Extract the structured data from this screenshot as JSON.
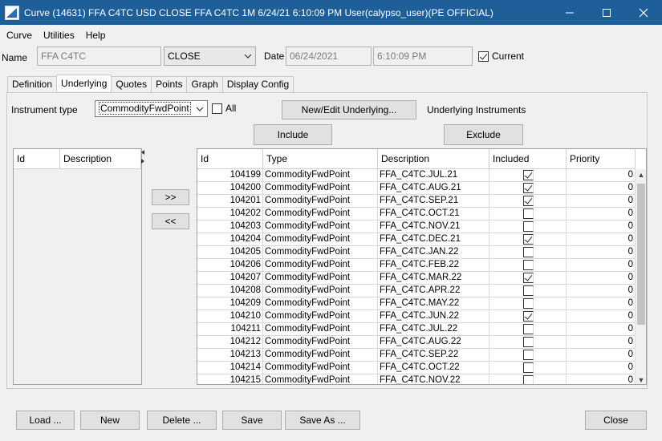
{
  "window": {
    "title": "Curve (14631) FFA C4TC USD CLOSE FFA C4TC 1M 6/24/21 6:10:09 PM User(calypso_user)(PE OFFICIAL)"
  },
  "menu": [
    "Curve",
    "Utilities",
    "Help"
  ],
  "name_row": {
    "name_label": "Name",
    "name_value": "FFA C4TC",
    "quote_set": "CLOSE",
    "date_label": "Date",
    "date_value": "06/24/2021",
    "time_value": "6:10:09 PM",
    "current_label": "Current",
    "current_checked": true
  },
  "tabs": [
    "Definition",
    "Underlying",
    "Quotes",
    "Points",
    "Graph",
    "Display Config"
  ],
  "active_tab": "Underlying",
  "underlying": {
    "instrument_type_label": "Instrument type",
    "instrument_type_value": "CommodityFwdPoint",
    "all_label": "All",
    "new_edit_button": "New/Edit Underlying...",
    "underlying_instruments_label": "Underlying Instruments",
    "include_button": "Include",
    "exclude_button": "Exclude",
    "move_right_button": ">>",
    "move_left_button": "<<"
  },
  "left_table": {
    "columns": [
      "Id",
      "Description"
    ]
  },
  "grid": {
    "columns": [
      "Id",
      "Type",
      "Description",
      "Included",
      "Priority"
    ],
    "rows": [
      {
        "id": "104199",
        "type": "CommodityFwdPoint",
        "desc": "FFA_C4TC.JUL.21",
        "included": true,
        "priority": "0"
      },
      {
        "id": "104200",
        "type": "CommodityFwdPoint",
        "desc": "FFA_C4TC.AUG.21",
        "included": true,
        "priority": "0"
      },
      {
        "id": "104201",
        "type": "CommodityFwdPoint",
        "desc": "FFA_C4TC.SEP.21",
        "included": true,
        "priority": "0"
      },
      {
        "id": "104202",
        "type": "CommodityFwdPoint",
        "desc": "FFA_C4TC.OCT.21",
        "included": false,
        "priority": "0"
      },
      {
        "id": "104203",
        "type": "CommodityFwdPoint",
        "desc": "FFA_C4TC.NOV.21",
        "included": false,
        "priority": "0"
      },
      {
        "id": "104204",
        "type": "CommodityFwdPoint",
        "desc": "FFA_C4TC.DEC.21",
        "included": true,
        "priority": "0"
      },
      {
        "id": "104205",
        "type": "CommodityFwdPoint",
        "desc": "FFA_C4TC.JAN.22",
        "included": false,
        "priority": "0"
      },
      {
        "id": "104206",
        "type": "CommodityFwdPoint",
        "desc": "FFA_C4TC.FEB.22",
        "included": false,
        "priority": "0"
      },
      {
        "id": "104207",
        "type": "CommodityFwdPoint",
        "desc": "FFA_C4TC.MAR.22",
        "included": true,
        "priority": "0"
      },
      {
        "id": "104208",
        "type": "CommodityFwdPoint",
        "desc": "FFA_C4TC.APR.22",
        "included": false,
        "priority": "0"
      },
      {
        "id": "104209",
        "type": "CommodityFwdPoint",
        "desc": "FFA_C4TC.MAY.22",
        "included": false,
        "priority": "0"
      },
      {
        "id": "104210",
        "type": "CommodityFwdPoint",
        "desc": "FFA_C4TC.JUN.22",
        "included": true,
        "priority": "0"
      },
      {
        "id": "104211",
        "type": "CommodityFwdPoint",
        "desc": "FFA_C4TC.JUL.22",
        "included": false,
        "priority": "0"
      },
      {
        "id": "104212",
        "type": "CommodityFwdPoint",
        "desc": "FFA_C4TC.AUG.22",
        "included": false,
        "priority": "0"
      },
      {
        "id": "104213",
        "type": "CommodityFwdPoint",
        "desc": "FFA_C4TC.SEP.22",
        "included": false,
        "priority": "0"
      },
      {
        "id": "104214",
        "type": "CommodityFwdPoint",
        "desc": "FFA_C4TC.OCT.22",
        "included": false,
        "priority": "0"
      },
      {
        "id": "104215",
        "type": "CommodityFwdPoint",
        "desc": "FFA_C4TC.NOV.22",
        "included": false,
        "priority": "0"
      }
    ]
  },
  "bottom_buttons": {
    "load": "Load ...",
    "new": "New",
    "delete": "Delete ...",
    "save": "Save",
    "save_as": "Save As ...",
    "close": "Close"
  },
  "colors": {
    "titlebar": "#1f5f99",
    "background": "#f0f0f0"
  }
}
